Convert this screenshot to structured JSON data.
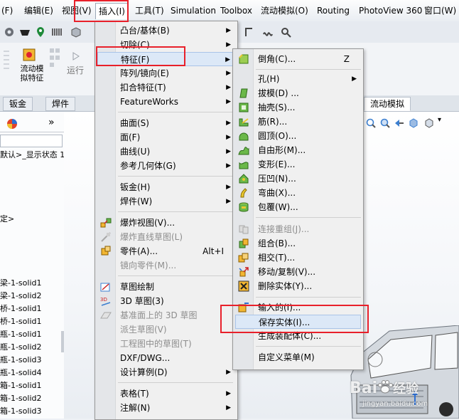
{
  "menubar": {
    "items": [
      "(F)",
      "编辑(E)",
      "视图(V)",
      "插入(I)",
      "工具(T)",
      "Simulation",
      "Toolbox",
      "流动模拟(O)",
      "Routing",
      "PhotoView 360",
      "窗口(W)"
    ]
  },
  "command_manager": {
    "btn1": "流动模\n拟特征",
    "btn2": "运行",
    "tabs": [
      "钣金",
      "焊件",
      "流动模拟"
    ]
  },
  "feature_tree": {
    "rows": [
      "默认>_显示状态 1",
      "定>",
      "梁-1-solid1",
      "梁-1-solid2",
      "桥-1-solid1",
      "桥-1-solid1",
      "瓶-1-solid1",
      "瓶-1-solid2",
      "瓶-1-solid3",
      "瓶-1-solid4",
      "箱-1-solid1",
      "箱-1-solid2",
      "箱-1-solid3"
    ]
  },
  "insert_menu": {
    "items": [
      {
        "label": "凸台/基体(B)",
        "submenu": true
      },
      {
        "label": "切除(C)",
        "submenu": true
      },
      {
        "label": "特征(F)",
        "submenu": true,
        "highlighted": true
      },
      {
        "label": "阵列/镜向(E)",
        "submenu": true
      },
      {
        "label": "扣合特征(T)",
        "submenu": true
      },
      {
        "label": "FeatureWorks",
        "submenu": true
      },
      {
        "label": "曲面(S)",
        "submenu": true
      },
      {
        "label": "面(F)",
        "submenu": true
      },
      {
        "label": "曲线(U)",
        "submenu": true
      },
      {
        "label": "参考几何体(G)",
        "submenu": true
      },
      {
        "label": "钣金(H)",
        "submenu": true
      },
      {
        "label": "焊件(W)",
        "submenu": true
      },
      {
        "label": "爆炸视图(V)..."
      },
      {
        "label": "爆炸直线草图(L)",
        "disabled": true
      },
      {
        "label": "零件(A)...",
        "shortcut": "Alt+I"
      },
      {
        "label": "镜向零件(M)...",
        "disabled": true
      },
      {
        "label": "草图绘制"
      },
      {
        "label": "3D 草图(3)"
      },
      {
        "label": "基准面上的 3D 草图",
        "disabled": true
      },
      {
        "label": "派生草图(V)",
        "disabled": true
      },
      {
        "label": "工程图中的草图(T)",
        "disabled": true
      },
      {
        "label": "DXF/DWG..."
      },
      {
        "label": "设计算例(D)",
        "submenu": true
      },
      {
        "label": "表格(T)",
        "submenu": true
      },
      {
        "label": "注解(N)",
        "submenu": true
      }
    ]
  },
  "feature_submenu": {
    "items": [
      {
        "label": "倒角(C)...",
        "shortcut": "Z"
      },
      {
        "label": "孔(H)",
        "submenu": true
      },
      {
        "label": "拔模(D) ..."
      },
      {
        "label": "抽壳(S)..."
      },
      {
        "label": "筋(R)..."
      },
      {
        "label": "圆顶(O)..."
      },
      {
        "label": "自由形(M)..."
      },
      {
        "label": "变形(E)..."
      },
      {
        "label": "压凹(N)..."
      },
      {
        "label": "弯曲(X)..."
      },
      {
        "label": "包覆(W)..."
      },
      {
        "label": "连接重组(J)...",
        "disabled": true
      },
      {
        "label": "组合(B)..."
      },
      {
        "label": "相交(T)..."
      },
      {
        "label": "移动/复制(V)..."
      },
      {
        "label": "删除实体(Y)..."
      },
      {
        "label": "输入的(I)..."
      },
      {
        "label": "保存实体(I)...",
        "highlighted": true
      },
      {
        "label": "生成装配体(C)..."
      },
      {
        "label": "自定义菜单(M)"
      }
    ]
  },
  "watermark": {
    "brand": "Bai",
    "sub": "经验",
    "site": "jingyan.baidu.com"
  },
  "colors": {
    "highlight_box": "#e8202a",
    "menu_hover": "#dce8f7",
    "accent": "#3c7fd0"
  }
}
